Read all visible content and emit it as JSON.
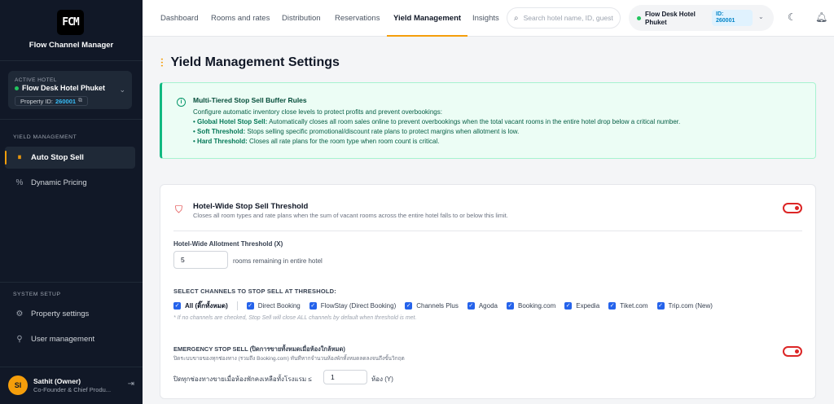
{
  "sidebar": {
    "logo_text": "FCM",
    "app_name": "Flow Channel Manager",
    "hotel_card": {
      "label": "ACTIVE HOTEL",
      "name": "Flow Desk Hotel Phuket",
      "property_id_label": "Property ID:",
      "property_id": "260001"
    },
    "yield_section": "YIELD MANAGEMENT",
    "yield_items": [
      {
        "label": "Auto Stop Sell",
        "icon": "stop-sell-icon",
        "active": true
      },
      {
        "label": "Dynamic Pricing",
        "icon": "percent-icon",
        "active": false
      }
    ],
    "system_section": "SYSTEM SETUP",
    "system_items": [
      {
        "label": "Property settings",
        "icon": "gear-icon"
      },
      {
        "label": "User management",
        "icon": "users-icon"
      }
    ],
    "user": {
      "initials": "SI",
      "name": "Sathit (Owner)",
      "role": "Co-Founder & Chief Produ..."
    }
  },
  "topnav": {
    "tabs": [
      {
        "label": "Dashboard"
      },
      {
        "label": "Rooms and rates"
      },
      {
        "label": "Distribution"
      },
      {
        "label": "Reservations"
      },
      {
        "label": "Yield Management",
        "active": true
      },
      {
        "label": "Insights"
      }
    ],
    "search_placeholder": "Search hotel name, ID, guest...",
    "hotel_pill": {
      "name": "Flow Desk Hotel Phuket",
      "id_label": "ID:",
      "id": "260001"
    }
  },
  "main": {
    "title": "Yield Management Settings",
    "info": {
      "title": "Multi-Tiered Stop Sell Buffer Rules",
      "intro": "Configure automatic inventory close levels to protect profits and prevent overbookings:",
      "rules": [
        {
          "name": "Global Hotel Stop Sell:",
          "text": " Automatically closes all room sales online to prevent overbookings when the total vacant rooms in the entire hotel drop below a critical number."
        },
        {
          "name": "Soft Threshold:",
          "text": " Stops selling specific promotional/discount rate plans to protect margins when allotment is low."
        },
        {
          "name": "Hard Threshold:",
          "text": " Closes all rate plans for the room type when room count is critical."
        }
      ],
      "bullet": "•"
    },
    "panel": {
      "title": "Hotel-Wide Stop Sell Threshold",
      "subtitle": "Closes all room types and rate plans when the sum of vacant rooms across the entire hotel falls to or below this limit.",
      "threshold_label": "Hotel-Wide Allotment Threshold (X)",
      "threshold_value": "5",
      "threshold_suffix": "rooms remaining in entire hotel",
      "channels_label": "SELECT CHANNELS TO STOP SELL AT THRESHOLD:",
      "channels": [
        {
          "label": "All (ติ๊กทั้งหมด)",
          "checked": true
        },
        {
          "label": "Direct Booking",
          "checked": true
        },
        {
          "label": "FlowStay (Direct Booking)",
          "checked": true
        },
        {
          "label": "Channels Plus",
          "checked": true
        },
        {
          "label": "Agoda",
          "checked": true
        },
        {
          "label": "Booking.com",
          "checked": true
        },
        {
          "label": "Expedia",
          "checked": true
        },
        {
          "label": "Tiket.com",
          "checked": true
        },
        {
          "label": "Trip.com (New)",
          "checked": true
        }
      ],
      "channels_note": "* If no channels are checked, Stop Sell will close ALL channels by default when threshold is met.",
      "emergency_title": "EMERGENCY STOP SELL (ปิดการขายทั้งหมดเมื่อห้องใกล้หมด)",
      "emergency_sub": "ปิดระบบขายของทุกช่องทาง (รวมถึง Booking.com) ทันทีหากจำนวนห้องพักทั้งหมดลดลงจนถึงขั้นวิกฤต",
      "emergency_label": "ปิดทุกช่องทางขายเมื่อห้องพักคงเหลือทั้งโรงแรม ≤",
      "emergency_value": "1",
      "emergency_suffix": "ห้อง (Y)"
    }
  },
  "colors": {
    "sidebar_bg": "#111827",
    "accent": "#f59e0b",
    "toggle_red": "#dc2626",
    "info_green": "#10b981",
    "checkbox_blue": "#2563eb"
  }
}
